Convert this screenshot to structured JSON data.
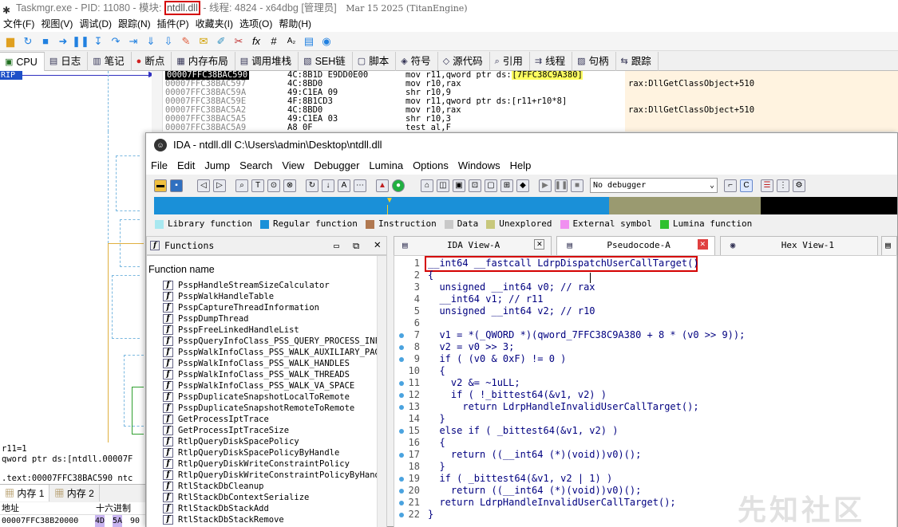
{
  "debugger": {
    "title_prefix": "Taskmgr.exe - PID: 11080 - 模块: ",
    "title_module": "ntdll.dll",
    "title_suffix": " - 线程: 4824 - x64dbg [管理员]",
    "title_date": "Mar 15 2025 (TitanEngine)",
    "menu": [
      "文件(F)",
      "视图(V)",
      "调试(D)",
      "跟踪(N)",
      "插件(P)",
      "收藏夹(I)",
      "选项(O)",
      "帮助(H)"
    ],
    "tabs": [
      {
        "label": "CPU",
        "icon": "cpu-icon"
      },
      {
        "label": "日志",
        "icon": "log-icon"
      },
      {
        "label": "笔记",
        "icon": "notes-icon"
      },
      {
        "label": "断点",
        "icon": "breakpoint-icon"
      },
      {
        "label": "内存布局",
        "icon": "memory-map-icon"
      },
      {
        "label": "调用堆栈",
        "icon": "call-stack-icon"
      },
      {
        "label": "SEH链",
        "icon": "seh-icon"
      },
      {
        "label": "脚本",
        "icon": "script-icon"
      },
      {
        "label": "符号",
        "icon": "symbols-icon"
      },
      {
        "label": "源代码",
        "icon": "source-icon"
      },
      {
        "label": "引用",
        "icon": "references-icon"
      },
      {
        "label": "线程",
        "icon": "threads-icon"
      },
      {
        "label": "句柄",
        "icon": "handles-icon"
      },
      {
        "label": "跟踪",
        "icon": "trace-icon"
      }
    ],
    "rip_label": "RIP",
    "disasm": [
      {
        "addr": "00007FFC38BAC590",
        "bytes": "4C:8B1D E9DD0E00",
        "asm_pre": "mov r11,qword ptr ds:",
        "asm_hl": "[7FFC38C9A380]",
        "comment": ""
      },
      {
        "addr": "00007FFC38BAC597",
        "bytes": "4C:8BD0",
        "asm_pre": "mov r10,rax",
        "asm_hl": "",
        "comment": "rax:DllGetClassObject+510"
      },
      {
        "addr": "00007FFC38BAC59A",
        "bytes": "49:C1EA 09",
        "asm_pre": "shr r10,9",
        "asm_hl": "",
        "comment": ""
      },
      {
        "addr": "00007FFC38BAC59E",
        "bytes": "4F:8B1CD3",
        "asm_pre": "mov r11,qword ptr ds:[r11+r10*8]",
        "asm_hl": "",
        "comment": ""
      },
      {
        "addr": "00007FFC38BAC5A2",
        "bytes": "4C:8BD0",
        "asm_pre": "mov r10,rax",
        "asm_hl": "",
        "comment": "rax:DllGetClassObject+510"
      },
      {
        "addr": "00007FFC38BAC5A5",
        "bytes": "49:C1EA 03",
        "asm_pre": "shr r10,3",
        "asm_hl": "",
        "comment": ""
      },
      {
        "addr": "00007FFC38BAC5A9",
        "bytes": "A8 0F",
        "asm_pre": "test al,F",
        "asm_hl": "",
        "comment": ""
      }
    ],
    "reg_lines": [
      "r11=1",
      "qword ptr ds:[ntdll.00007F",
      "",
      ".text:00007FFC38BAC590 ntc"
    ],
    "mem_tabs": [
      "内存 1",
      "内存 2"
    ],
    "mem_header": {
      "addr": "地址",
      "hex": "十六进制"
    },
    "mem_row": {
      "addr": "00007FFC38B20000",
      "b1": "4D",
      "b2": "5A",
      "b3": "90"
    }
  },
  "ida": {
    "title": "IDA - ntdll.dll C:\\Users\\admin\\Desktop\\ntdll.dll",
    "menu": [
      "File",
      "Edit",
      "Jump",
      "Search",
      "View",
      "Debugger",
      "Lumina",
      "Options",
      "Windows",
      "Help"
    ],
    "debugger_select": "No debugger",
    "legend": [
      {
        "label": "Library function",
        "color": "#a8e8f0"
      },
      {
        "label": "Regular function",
        "color": "#1a90d8"
      },
      {
        "label": "Instruction",
        "color": "#b07850"
      },
      {
        "label": "Data",
        "color": "#c8c8c8"
      },
      {
        "label": "Unexplored",
        "color": "#c8c87c"
      },
      {
        "label": "External symbol",
        "color": "#f090f0"
      },
      {
        "label": "Lumina function",
        "color": "#30c030"
      }
    ],
    "functions_title": "Functions",
    "function_column": "Function name",
    "functions": [
      "PsspHandleStreamSizeCalculator",
      "PsspWalkHandleTable",
      "PsspCaptureThreadInformation",
      "PsspDumpThread",
      "PsspFreeLinkedHandleList",
      "PsspQueryInfoClass_PSS_QUERY_PROCESS_INFO",
      "PsspWalkInfoClass_PSS_WALK_AUXILIARY_PAGE",
      "PsspWalkInfoClass_PSS_WALK_HANDLES",
      "PsspWalkInfoClass_PSS_WALK_THREADS",
      "PsspWalkInfoClass_PSS_WALK_VA_SPACE",
      "PsspDuplicateSnapshotLocalToRemote",
      "PsspDuplicateSnapshotRemoteToRemote",
      "GetProcessIptTrace",
      "GetProcessIptTraceSize",
      "RtlpQueryDiskSpacePolicy",
      "RtlpQueryDiskSpacePolicyByHandle",
      "RtlpQueryDiskWriteConstraintPolicy",
      "RtlpQueryDiskWriteConstraintPolicyByHandle",
      "RtlStackDbCleanup",
      "RtlStackDbContextSerialize",
      "RtlStackDbStackAdd",
      "RtlStackDbStackRemove"
    ],
    "view_tabs": [
      "IDA View-A",
      "Pseudocode-A",
      "Hex View-1"
    ],
    "code": [
      {
        "n": "1",
        "t": "__int64 __fastcall LdrpDispatchUserCallTarget()",
        "dot": false
      },
      {
        "n": "2",
        "t": "{",
        "dot": false
      },
      {
        "n": "3",
        "t": "  unsigned __int64 v0; // rax",
        "dot": false
      },
      {
        "n": "4",
        "t": "  __int64 v1; // r11",
        "dot": false
      },
      {
        "n": "5",
        "t": "  unsigned __int64 v2; // r10",
        "dot": false
      },
      {
        "n": "6",
        "t": "",
        "dot": false
      },
      {
        "n": "7",
        "t": "  v1 = *(_QWORD *)(qword_7FFC38C9A380 + 8 * (v0 >> 9));",
        "dot": true
      },
      {
        "n": "8",
        "t": "  v2 = v0 >> 3;",
        "dot": true
      },
      {
        "n": "9",
        "t": "  if ( (v0 & 0xF) != 0 )",
        "dot": true
      },
      {
        "n": "10",
        "t": "  {",
        "dot": false
      },
      {
        "n": "11",
        "t": "    v2 &= ~1uLL;",
        "dot": true
      },
      {
        "n": "12",
        "t": "    if ( !_bittest64(&v1, v2) )",
        "dot": true
      },
      {
        "n": "13",
        "t": "      return LdrpHandleInvalidUserCallTarget();",
        "dot": true
      },
      {
        "n": "14",
        "t": "  }",
        "dot": false
      },
      {
        "n": "15",
        "t": "  else if ( _bittest64(&v1, v2) )",
        "dot": true
      },
      {
        "n": "16",
        "t": "  {",
        "dot": false
      },
      {
        "n": "17",
        "t": "    return ((__int64 (*)(void))v0)();",
        "dot": true
      },
      {
        "n": "18",
        "t": "  }",
        "dot": false
      },
      {
        "n": "19",
        "t": "  if ( _bittest64(&v1, v2 | 1) )",
        "dot": true
      },
      {
        "n": "20",
        "t": "    return ((__int64 (*)(void))v0)();",
        "dot": true
      },
      {
        "n": "21",
        "t": "  return LdrpHandleInvalidUserCallTarget();",
        "dot": true
      },
      {
        "n": "22",
        "t": "}",
        "dot": true
      }
    ]
  },
  "watermark": "先知社区"
}
